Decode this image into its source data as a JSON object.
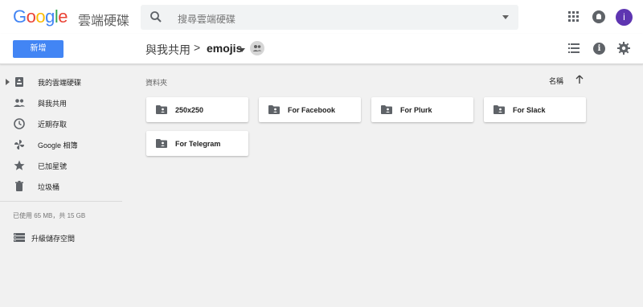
{
  "header": {
    "logo": "Google",
    "product": "雲端硬碟",
    "search_placeholder": "搜尋雲端硬碟",
    "avatar_letter": "i"
  },
  "toolbar": {
    "new_label": "新增",
    "breadcrumb_root": "與我共用",
    "breadcrumb_sep": ">",
    "current_folder": "emojis"
  },
  "sidebar": {
    "items": [
      {
        "label": "我的雲端硬碟",
        "icon": "drive-icon"
      },
      {
        "label": "與我共用",
        "icon": "people-icon"
      },
      {
        "label": "近期存取",
        "icon": "clock-icon"
      },
      {
        "label": "Google 相簿",
        "icon": "pinwheel-icon"
      },
      {
        "label": "已加星號",
        "icon": "star-icon"
      },
      {
        "label": "垃圾桶",
        "icon": "trash-icon"
      }
    ],
    "storage": "已使用 65 MB，共 15 GB",
    "upgrade": "升級儲存空間"
  },
  "main": {
    "section_label": "資料夾",
    "sort_label": "名稱",
    "folders": [
      {
        "name": "250x250"
      },
      {
        "name": "For Facebook"
      },
      {
        "name": "For Plurk"
      },
      {
        "name": "For Slack"
      },
      {
        "name": "For Telegram"
      }
    ]
  },
  "colors": {
    "accent": "#4285f4",
    "avatar": "#5e35b1",
    "background": "#f1f1f1"
  }
}
